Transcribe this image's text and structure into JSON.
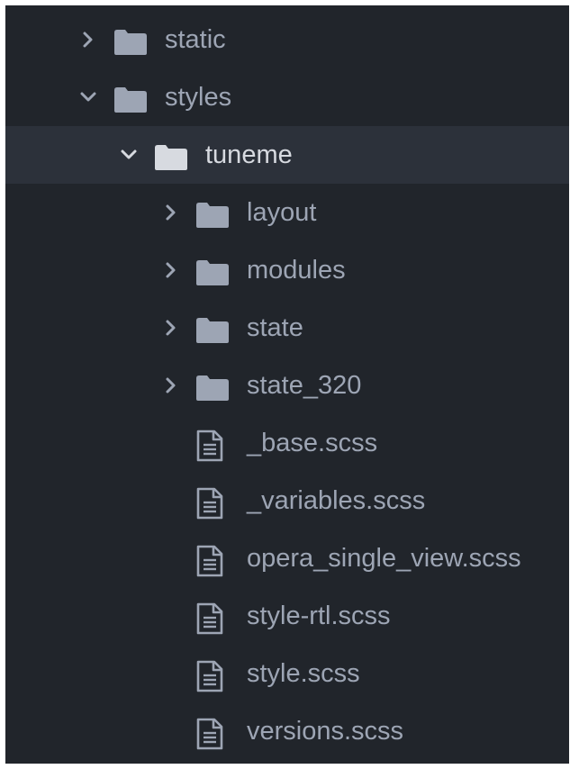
{
  "colors": {
    "panel_background": "#21252b",
    "selected_row_background": "#2c313a",
    "text": "#9da5b4",
    "selected_text": "#d7dae0",
    "folder_icon": "#9da5b4",
    "selected_folder_icon": "#d7dae0"
  },
  "tree": {
    "rows": [
      {
        "kind": "folder",
        "label": "static",
        "expanded": false,
        "icon": "folder-icon",
        "chevron": "chevron-right-icon"
      },
      {
        "kind": "folder",
        "label": "styles",
        "expanded": true,
        "icon": "folder-icon",
        "chevron": "chevron-down-icon"
      },
      {
        "kind": "folder",
        "label": "tuneme",
        "expanded": true,
        "selected": true,
        "icon": "folder-icon",
        "chevron": "chevron-down-icon"
      },
      {
        "kind": "folder",
        "label": "layout",
        "expanded": false,
        "icon": "folder-icon",
        "chevron": "chevron-right-icon"
      },
      {
        "kind": "folder",
        "label": "modules",
        "expanded": false,
        "icon": "folder-icon",
        "chevron": "chevron-right-icon"
      },
      {
        "kind": "folder",
        "label": "state",
        "expanded": false,
        "icon": "folder-icon",
        "chevron": "chevron-right-icon"
      },
      {
        "kind": "folder",
        "label": "state_320",
        "expanded": false,
        "icon": "folder-icon",
        "chevron": "chevron-right-icon"
      },
      {
        "kind": "file",
        "label": "_base.scss",
        "icon": "file-text-icon"
      },
      {
        "kind": "file",
        "label": "_variables.scss",
        "icon": "file-text-icon"
      },
      {
        "kind": "file",
        "label": "opera_single_view.scss",
        "icon": "file-text-icon"
      },
      {
        "kind": "file",
        "label": "style-rtl.scss",
        "icon": "file-text-icon"
      },
      {
        "kind": "file",
        "label": "style.scss",
        "icon": "file-text-icon"
      },
      {
        "kind": "file",
        "label": "versions.scss",
        "icon": "file-text-icon"
      }
    ]
  }
}
